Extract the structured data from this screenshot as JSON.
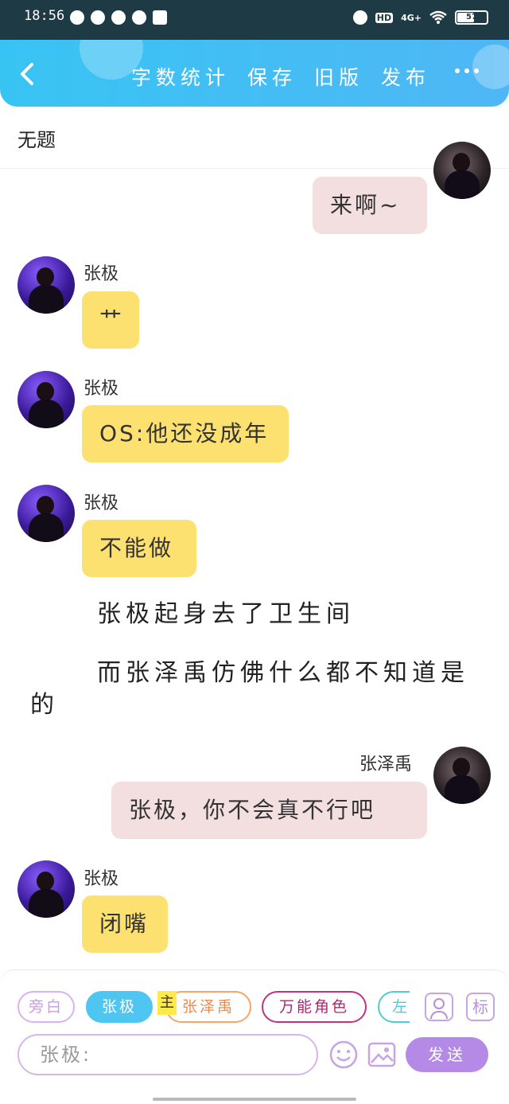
{
  "status_bar": {
    "time": "18:56",
    "network": "4G+",
    "hd": "HD",
    "battery_level": "57",
    "battery_fraction": 0.57
  },
  "header": {
    "actions": [
      "字数统计",
      "保存",
      "旧版",
      "发布"
    ]
  },
  "document": {
    "title": "无题"
  },
  "messages": [
    {
      "side": "right",
      "speaker": "",
      "text": "来啊~"
    },
    {
      "side": "left",
      "speaker": "张极",
      "text": "艹"
    },
    {
      "side": "left",
      "speaker": "张极",
      "text": "OS:他还没成年"
    },
    {
      "side": "left",
      "speaker": "张极",
      "text": "不能做"
    },
    {
      "side": "narration",
      "text": "张极起身去了卫生间"
    },
    {
      "side": "narration",
      "text": "而张泽禹仿佛什么都不知道是的"
    },
    {
      "side": "right",
      "speaker": "张泽禹",
      "text": "张极，你不会真不行吧"
    },
    {
      "side": "left",
      "speaker": "张极",
      "text": "闭嘴"
    }
  ],
  "roles": {
    "narration": "旁白",
    "zhangji": "张极",
    "main_badge": "主",
    "zhangzeyu": "张泽禹",
    "any_role": "万能角色",
    "left": "左"
  },
  "tools": {
    "role_icon": "person-icon",
    "mark_label": "标"
  },
  "composer": {
    "placeholder": "张极:",
    "send_label": "发送",
    "emoji_icon": "smile-icon",
    "image_icon": "image-icon"
  },
  "colors": {
    "header": "#38c4f3",
    "left_bubble": "#fde170",
    "right_bubble": "#f4dfe0",
    "send_button": "#b48ae6"
  }
}
